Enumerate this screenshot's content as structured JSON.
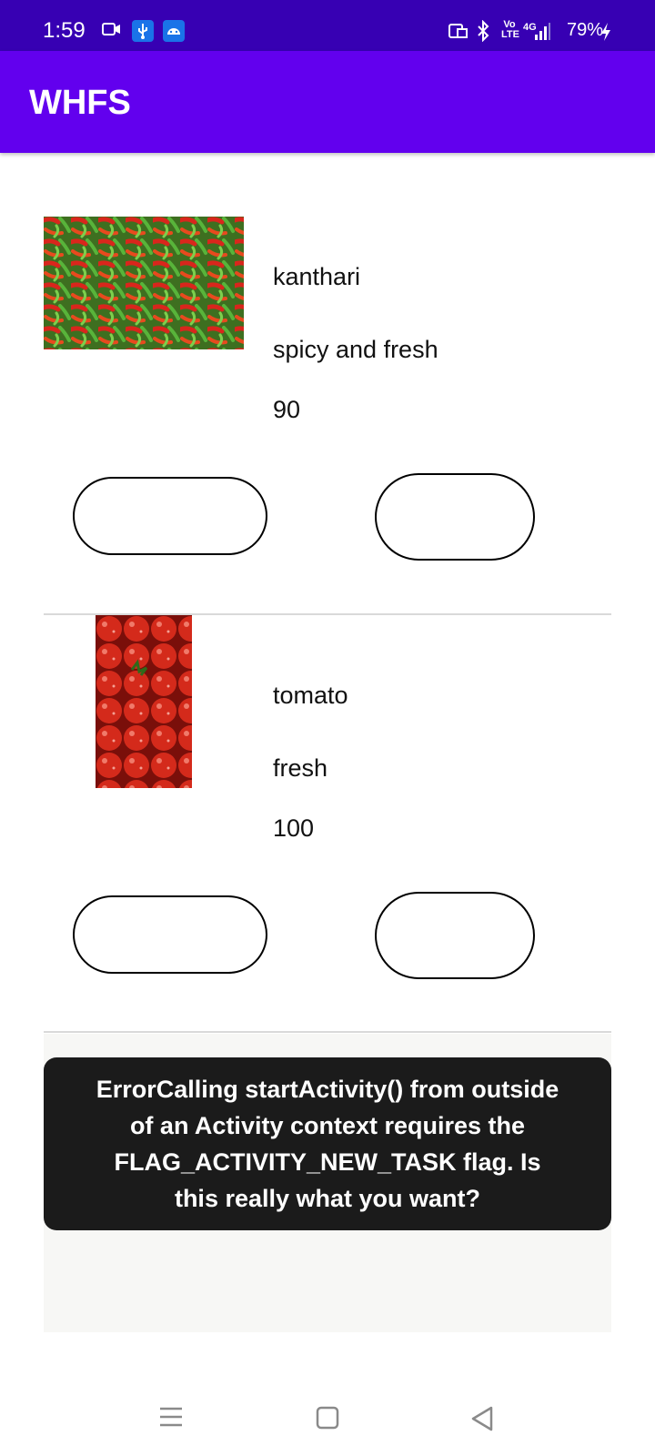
{
  "status_bar": {
    "time": "1:59",
    "battery": "79%",
    "network": "4G",
    "volte": "Vo LTE",
    "left_icons": [
      "video-camera-icon",
      "usb-icon",
      "android-icon"
    ],
    "right_icons": [
      "cast-icon",
      "bluetooth-icon",
      "volte-icon",
      "signal-icon",
      "battery-charging-icon"
    ]
  },
  "app_bar": {
    "title": "WHFS"
  },
  "products": [
    {
      "name": "kanthari",
      "description": "spicy and fresh",
      "price": "90",
      "image": "chili-peppers-photo"
    },
    {
      "name": "tomato",
      "description": "fresh",
      "price": "100",
      "image": "tomatoes-photo"
    }
  ],
  "toast": {
    "message": "ErrorCalling startActivity() from outside of an Activity  context requires the FLAG_ACTIVITY_NEW_TASK flag. Is this really what you want?"
  },
  "nav_bar": {
    "icons": [
      "menu-icon",
      "home-icon",
      "back-icon"
    ]
  },
  "colors": {
    "status_bar": "#3700b3",
    "app_bar": "#6200ee",
    "toast_bg": "#1b1b1b",
    "usb_badge": "#1a73e8"
  }
}
